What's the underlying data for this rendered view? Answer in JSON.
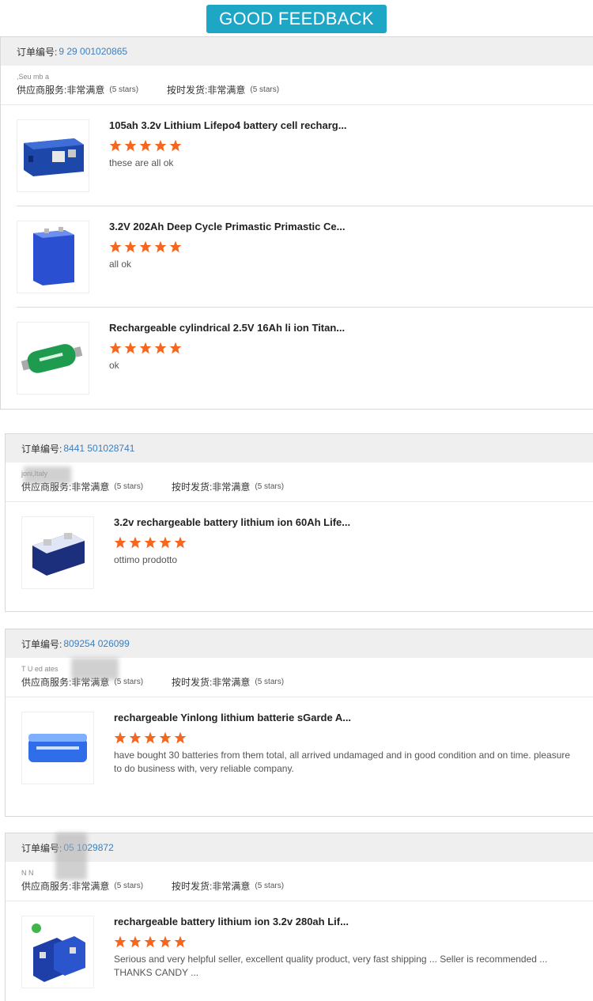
{
  "banner": "GOOD FEEDBACK",
  "labels": {
    "order_label": "订单编号:",
    "supplier_service": "供应商服务:",
    "on_time": "按时发货:",
    "very_satisfied": "非常满意",
    "five_stars": "(5 stars)"
  },
  "orders": [
    {
      "order_num": "9  29   001020865",
      "buyer": ",Seu      mb   a",
      "items": [
        {
          "title": "105ah 3.2v Lithium Lifepo4 battery cell recharg...",
          "comment": "these are all ok",
          "rating": 5,
          "image": "blue-prismatic-cell-large"
        },
        {
          "title": "3.2V 202Ah Deep Cycle Primastic Primastic Ce...",
          "comment": "all ok",
          "rating": 5,
          "image": "blue-prismatic-cell"
        },
        {
          "title": "Rechargeable cylindrical 2.5V 16Ah li ion Titan...",
          "comment": "ok",
          "rating": 5,
          "image": "green-cylinder-cell"
        }
      ]
    },
    {
      "order_num": "8441    501028741",
      "buyer": "      joni,Italy",
      "items": [
        {
          "title": "3.2v rechargeable battery lithium ion 60Ah Life...",
          "comment": "ottimo prodotto",
          "rating": 5,
          "image": "blue-cell-terminals"
        }
      ]
    },
    {
      "order_num": "809254     026099",
      "buyer": "T    U     ed  ates",
      "items": [
        {
          "title": "rechargeable Yinlong lithium batterie sGarde A...",
          "comment": "have bought 30 batteries from them total, all arrived undamaged and in good condition and on time. pleasure to do business with, very reliable company.",
          "rating": 5,
          "image": "blue-cylinder-pack"
        }
      ]
    },
    {
      "order_num": "  05     1029872",
      "buyer": "N  N",
      "items": [
        {
          "title": "rechargeable battery lithium ion 3.2v 280ah Lif...",
          "comment": "Serious and very helpful seller, excellent quality product, very fast shipping ... Seller is recommended ... THANKS CANDY ...",
          "rating": 5,
          "image": "blue-cell-pair"
        }
      ]
    }
  ],
  "colors": {
    "banner_bg": "#1ea6c6",
    "star": "#f5661e",
    "order_num": "#3a7fc0"
  }
}
